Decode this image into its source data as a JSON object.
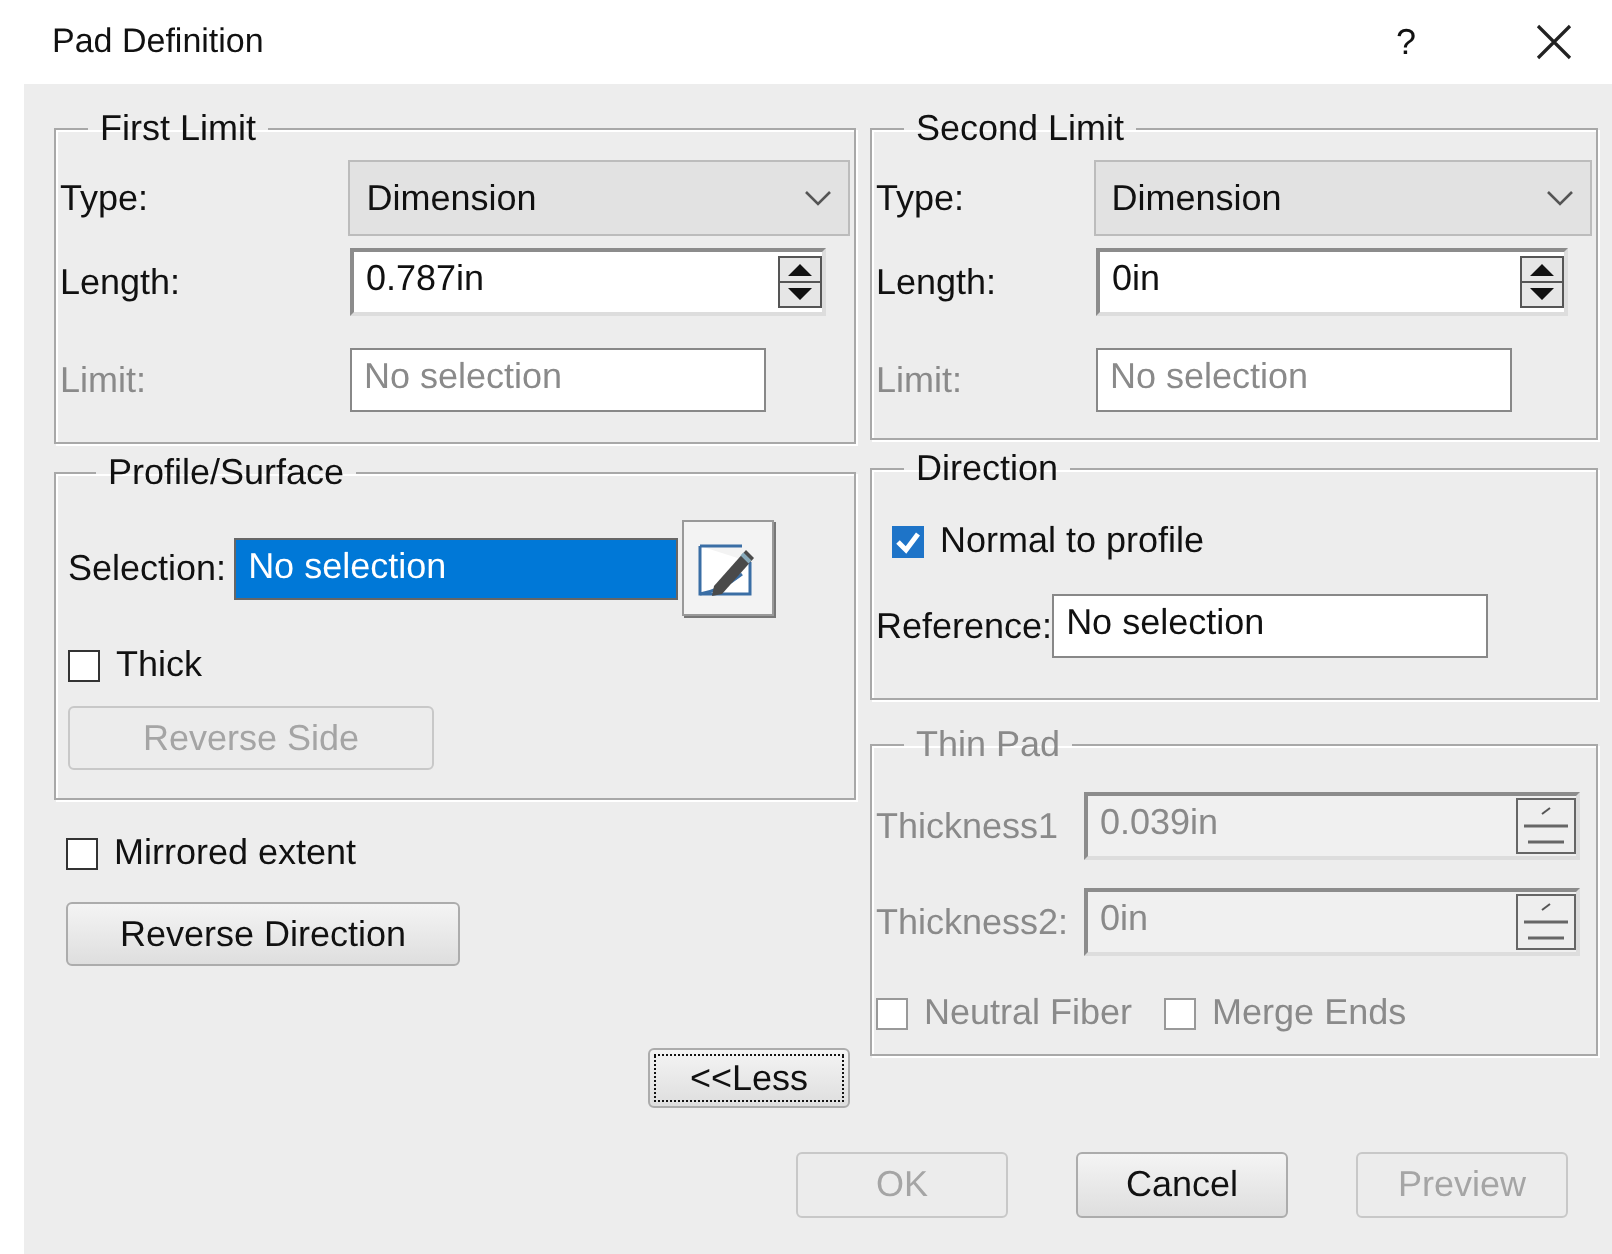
{
  "window": {
    "title": "Pad Definition",
    "help": "?"
  },
  "first_limit": {
    "title": "First Limit",
    "type": {
      "label": "Type:",
      "value": "Dimension"
    },
    "length": {
      "label": "Length:",
      "value": "0.787in"
    },
    "limit": {
      "label": "Limit:",
      "value": "No selection",
      "disabled": true
    }
  },
  "profile_surface": {
    "title": "Profile/Surface",
    "selection": {
      "label": "Selection:",
      "value": "No selection",
      "selected": true
    },
    "thick": {
      "label": "Thick",
      "checked": false
    },
    "reverse_side": {
      "label": "Reverse Side",
      "disabled": true
    }
  },
  "mirrored_extent": {
    "label": "Mirrored extent",
    "checked": false
  },
  "reverse_direction": {
    "label": "Reverse Direction"
  },
  "less_button": {
    "label": "<<Less",
    "focused": true
  },
  "second_limit": {
    "title": "Second Limit",
    "type": {
      "label": "Type:",
      "value": "Dimension"
    },
    "length": {
      "label": "Length:",
      "value": "0in"
    },
    "limit": {
      "label": "Limit:",
      "value": "No selection",
      "disabled": true
    }
  },
  "direction": {
    "title": "Direction",
    "normal_to_profile": {
      "label": "Normal to profile",
      "checked": true
    },
    "reference": {
      "label": "Reference:",
      "value": "No selection"
    }
  },
  "thin_pad": {
    "title": "Thin Pad",
    "disabled": true,
    "thickness1": {
      "label": "Thickness1",
      "value": "0.039in"
    },
    "thickness2": {
      "label": "Thickness2:",
      "value": "0in"
    },
    "options": [
      {
        "label": "Neutral Fiber",
        "checked": false
      },
      {
        "label": "Merge Ends",
        "checked": false
      }
    ]
  },
  "buttons": [
    {
      "label": "OK",
      "disabled": true
    },
    {
      "label": "Cancel",
      "disabled": false
    },
    {
      "label": "Preview",
      "disabled": true
    }
  ]
}
